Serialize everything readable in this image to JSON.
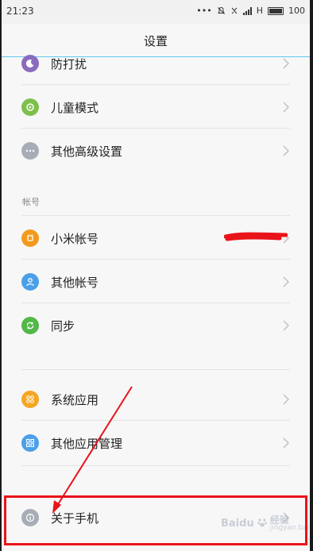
{
  "status": {
    "time": "21:23",
    "network": "H",
    "battery": "100"
  },
  "header": {
    "title": "设置"
  },
  "items": {
    "dnd": {
      "label": "防打扰",
      "icon": "moon-icon",
      "color": "#8a6bbe"
    },
    "kids": {
      "label": "儿童模式",
      "icon": "kids-mode-icon",
      "color": "#7dc04a"
    },
    "advanced": {
      "label": "其他高级设置",
      "icon": "more-dots-icon",
      "color": "#a7adb7"
    },
    "mi_account": {
      "label": "小米帐号",
      "icon": "mi-account-icon",
      "color": "#f39a1e"
    },
    "other_accounts": {
      "label": "其他帐号",
      "icon": "person-icon",
      "color": "#4a9fe8"
    },
    "sync": {
      "label": "同步",
      "icon": "sync-icon",
      "color": "#52b848"
    },
    "system_apps": {
      "label": "系统应用",
      "icon": "apps-grid-icon",
      "color": "#f5a623"
    },
    "app_manage": {
      "label": "其他应用管理",
      "icon": "app-manage-icon",
      "color": "#4a9fe8"
    },
    "about": {
      "label": "关于手机",
      "icon": "info-icon",
      "color": "#a7adb7"
    }
  },
  "sections": {
    "account": "帐号"
  },
  "watermark": {
    "brand": "Baidu",
    "sub": "经验",
    "domain": "jingyan.baidu.com"
  },
  "annotation_color": "#e8141a"
}
